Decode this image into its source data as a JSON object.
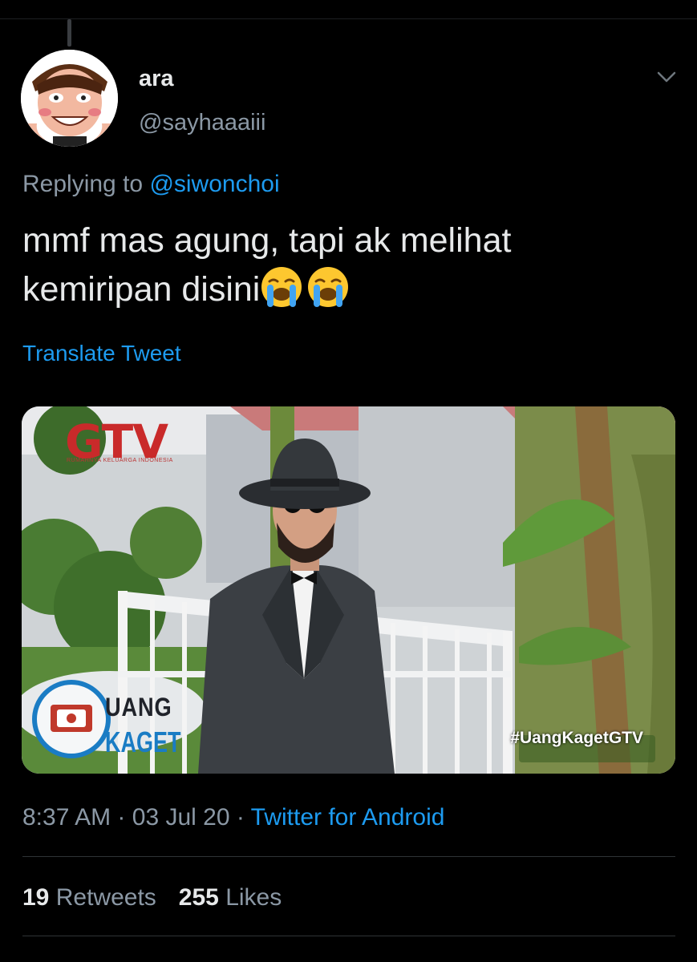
{
  "tweet": {
    "display_name": "ara",
    "handle": "@sayhaaaiii",
    "replying_prefix": "Replying to",
    "replying_to": "@siwonchoi",
    "text_line1": "mmf mas agung, tapi ak melihat",
    "text_line2": "kemiripan disini",
    "emojis": [
      "loudly-crying-face",
      "loudly-crying-face"
    ],
    "translate_label": "Translate Tweet",
    "media": {
      "brand": "GTV",
      "tagline": "RUMAHNYA KELUARGA INDONESIA",
      "show_line1": "UANG",
      "show_line2": "KAGET",
      "hashtag": "#UangKagetGTV"
    },
    "time": "8:37 AM",
    "date": "03 Jul 20",
    "separator": "·",
    "source": "Twitter for Android",
    "retweets_count": "19",
    "retweets_label": "Retweets",
    "likes_count": "255",
    "likes_label": "Likes"
  },
  "colors": {
    "background": "#000000",
    "text_primary": "#e7e9ea",
    "text_secondary": "#8b98a5",
    "link": "#1d9bf0"
  },
  "icons": {
    "more": "chevron-down-icon",
    "emoji": "loudly-crying-face-icon"
  }
}
